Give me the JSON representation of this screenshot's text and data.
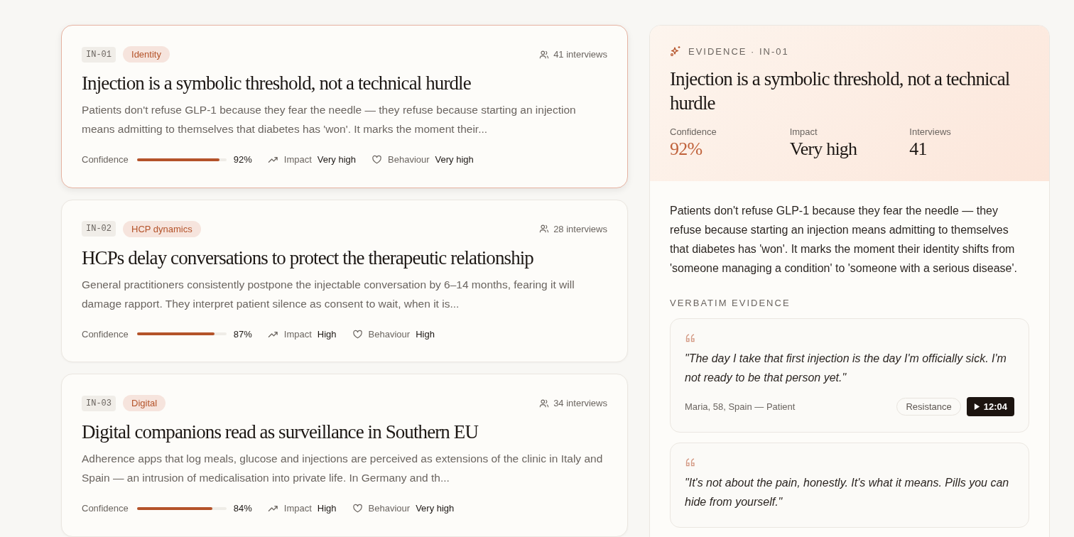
{
  "insights": [
    {
      "code": "IN-01",
      "tag": "Identity",
      "interviews": "41 interviews",
      "title": "Injection is a symbolic threshold, not a technical hurdle",
      "description": "Patients don't refuse GLP-1 because they fear the needle — they refuse because starting an injection means admitting to themselves that diabetes has 'won'. It marks the moment their...",
      "confidence_label": "Confidence",
      "level": 0.92,
      "confidence": "92%",
      "impact_label": "Impact",
      "impact": "Very high",
      "behaviour_label": "Behaviour",
      "behaviour": "Very high",
      "selected": true
    },
    {
      "code": "IN-02",
      "tag": "HCP dynamics",
      "interviews": "28 interviews",
      "title": "HCPs delay conversations to protect the therapeutic relationship",
      "description": "General practitioners consistently postpone the injectable conversation by 6–14 months, fearing it will damage rapport. They interpret patient silence as consent to wait, when it is...",
      "confidence_label": "Confidence",
      "level": 0.87,
      "confidence": "87%",
      "impact_label": "Impact",
      "impact": "High",
      "behaviour_label": "Behaviour",
      "behaviour": "High",
      "selected": false
    },
    {
      "code": "IN-03",
      "tag": "Digital",
      "interviews": "34 interviews",
      "title": "Digital companions read as surveillance in Southern EU",
      "description": "Adherence apps that log meals, glucose and injections are perceived as extensions of the clinic in Italy and Spain — an intrusion of medicalisation into private life. In Germany and th...",
      "confidence_label": "Confidence",
      "level": 0.84,
      "confidence": "84%",
      "impact_label": "Impact",
      "impact": "High",
      "behaviour_label": "Behaviour",
      "behaviour": "Very high",
      "selected": false
    }
  ],
  "evidence": {
    "eyebrow": "EVIDENCE · IN-01",
    "title": "Injection is a symbolic threshold, not a technical hurdle",
    "stats": [
      {
        "label": "Confidence",
        "value": "92%",
        "kind": "accent"
      },
      {
        "label": "Impact",
        "value": "Very high",
        "kind": "plain"
      },
      {
        "label": "Interviews",
        "value": "41",
        "kind": "plain"
      }
    ],
    "summary": "Patients don't refuse GLP-1 because they fear the needle — they refuse because starting an injection means admitting to themselves that diabetes has 'won'. It marks the moment their identity shifts from 'someone managing a condition' to 'someone with a serious disease'.",
    "verbatim_heading": "VERBATIM EVIDENCE",
    "quotes": [
      {
        "text": "\"The day I take that first injection is the day I'm officially sick. I'm not ready to be that person yet.\"",
        "source": "Maria, 58, Spain — Patient",
        "tag": "Resistance",
        "timestamp": "12:04"
      },
      {
        "text": "\"It's not about the pain, honestly. It's what it means. Pills you can hide from yourself.\""
      }
    ]
  }
}
